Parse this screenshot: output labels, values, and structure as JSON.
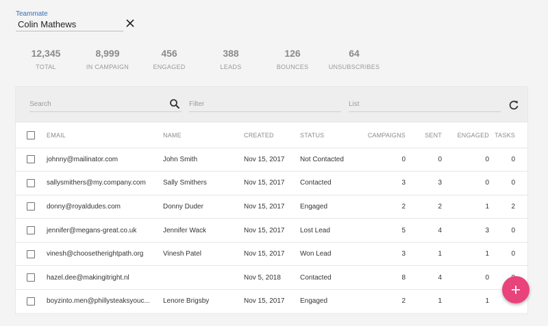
{
  "teammate": {
    "label": "Teammate",
    "value": "Colin Mathews"
  },
  "stats": [
    {
      "value": "12,345",
      "label": "TOTAL"
    },
    {
      "value": "8,999",
      "label": "IN CAMPAIGN"
    },
    {
      "value": "456",
      "label": "ENGAGED"
    },
    {
      "value": "388",
      "label": "LEADS"
    },
    {
      "value": "126",
      "label": "BOUNCES"
    },
    {
      "value": "64",
      "label": "UNSUBSCRIBES"
    }
  ],
  "toolbar": {
    "search_placeholder": "Search",
    "filter_placeholder": "Filter",
    "list_placeholder": "List"
  },
  "table": {
    "headers": {
      "email": "EMAIL",
      "name": "NAME",
      "created": "CREATED",
      "status": "STATUS",
      "campaigns": "CAMPAIGNS",
      "sent": "SENT",
      "engaged": "ENGAGED",
      "tasks": "TASKS"
    },
    "rows": [
      {
        "email": "johnny@mailinator.com",
        "name": "John Smith",
        "created": "Nov 15, 2017",
        "status": "Not Contacted",
        "campaigns": "0",
        "sent": "0",
        "engaged": "0",
        "tasks": "0"
      },
      {
        "email": "sallysmithers@my.company.com",
        "name": "Sally Smithers",
        "created": "Nov 15, 2017",
        "status": "Contacted",
        "campaigns": "3",
        "sent": "3",
        "engaged": "0",
        "tasks": "0"
      },
      {
        "email": "donny@royaldudes.com",
        "name": "Donny Duder",
        "created": "Nov 15, 2017",
        "status": "Engaged",
        "campaigns": "2",
        "sent": "2",
        "engaged": "1",
        "tasks": "2"
      },
      {
        "email": "jennifer@megans-great.co.uk",
        "name": "Jennifer Wack",
        "created": "Nov 15, 2017",
        "status": "Lost Lead",
        "campaigns": "5",
        "sent": "4",
        "engaged": "3",
        "tasks": "0"
      },
      {
        "email": "vinesh@choosetherightpath.org",
        "name": "Vinesh Patel",
        "created": "Nov 15, 2017",
        "status": "Won Lead",
        "campaigns": "3",
        "sent": "1",
        "engaged": "1",
        "tasks": "0"
      },
      {
        "email": "hazel.dee@makingitright.nl",
        "name": "",
        "created": "Nov 5, 2018",
        "status": "Contacted",
        "campaigns": "8",
        "sent": "4",
        "engaged": "0",
        "tasks": "0"
      },
      {
        "email": "boyzinto.men@phillysteaksyouc...",
        "name": "Lenore Brigsby",
        "created": "Nov 15, 2017",
        "status": "Engaged",
        "campaigns": "2",
        "sent": "1",
        "engaged": "1",
        "tasks": ""
      }
    ]
  },
  "fab": {
    "icon": "plus-icon"
  },
  "colors": {
    "accent": "#e8437a",
    "label_blue": "#2f6fb5"
  }
}
